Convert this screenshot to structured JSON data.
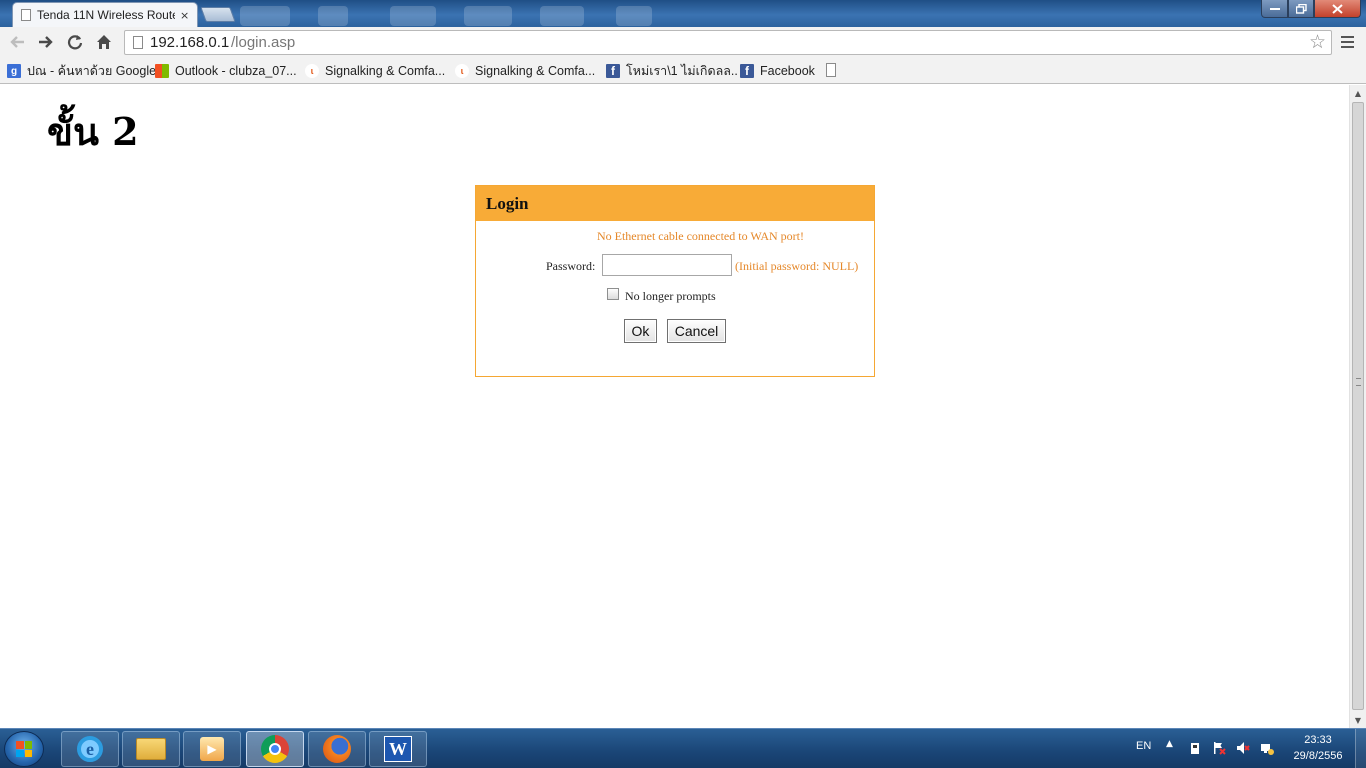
{
  "browser": {
    "tab_title": "Tenda 11N Wireless Route",
    "tab_close": "×",
    "url_host": "192.168.0.1",
    "url_path": "/login.asp",
    "icons": {
      "back": "back-arrow-icon",
      "forward": "forward-arrow-icon",
      "reload": "reload-icon",
      "home": "home-icon",
      "bookmark_star": "star-icon",
      "menu": "menu-icon"
    }
  },
  "bookmarks": [
    {
      "label": "ปณ - ค้นหาด้วย Google",
      "icon": "google-icon"
    },
    {
      "label": "Outlook - clubza_07...",
      "icon": "microsoft-icon"
    },
    {
      "label": "Signalking & Comfa...",
      "icon": "signalking-icon"
    },
    {
      "label": "Signalking & Comfa...",
      "icon": "signalking-icon"
    },
    {
      "label": "โหม่เรา\\1 ไม่เกิดลล..",
      "icon": "facebook-icon"
    },
    {
      "label": "Facebook",
      "icon": "facebook-icon"
    }
  ],
  "page": {
    "heading": "ขั้น 2",
    "login": {
      "title": "Login",
      "warning": "No Ethernet cable connected to WAN port!",
      "password_label": "Password:",
      "password_value": "",
      "password_hint": "(Initial password:  NULL)",
      "checkbox_label": "No longer prompts",
      "checkbox_checked": false,
      "ok_label": "Ok",
      "cancel_label": "Cancel"
    },
    "colors": {
      "header_bg": "#f8ab37",
      "border": "#f5a733",
      "warning_text": "#e5882a"
    }
  },
  "taskbar": {
    "apps": [
      {
        "name": "Internet Explorer",
        "icon": "ie-icon",
        "active": false
      },
      {
        "name": "Windows Explorer",
        "icon": "folder-icon",
        "active": false
      },
      {
        "name": "Windows Media Player",
        "icon": "media-player-icon",
        "active": false
      },
      {
        "name": "Google Chrome",
        "icon": "chrome-icon",
        "active": true
      },
      {
        "name": "Firefox",
        "icon": "firefox-icon",
        "active": false
      },
      {
        "name": "Microsoft Word",
        "icon": "word-icon",
        "active": false
      }
    ],
    "language": "EN",
    "tray_expand": "▲",
    "time": "23:33",
    "date": "29/8/2556"
  }
}
